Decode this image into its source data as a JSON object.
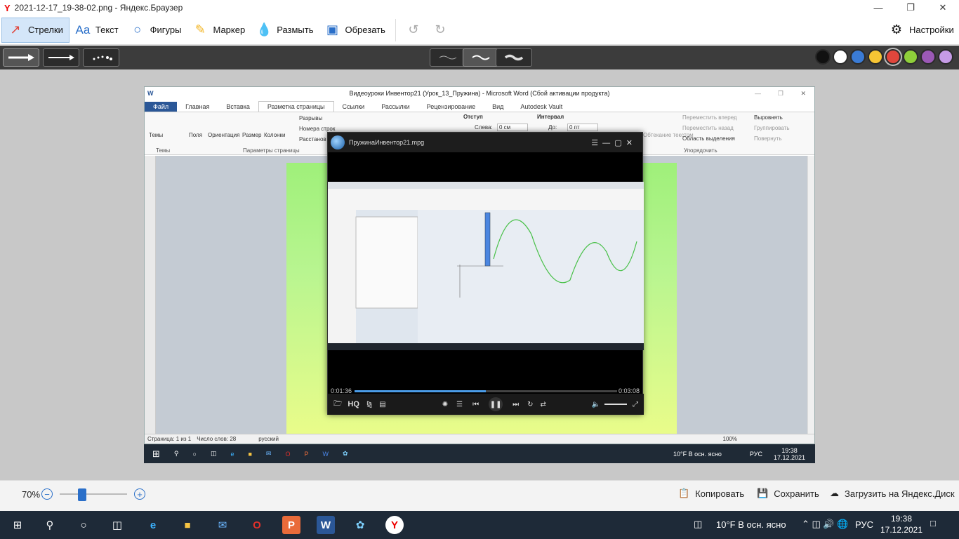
{
  "window": {
    "title": "2021-12-17_19-38-02.png - Яндекс.Браузер"
  },
  "toolbar": {
    "arrows": "Стрелки",
    "text": "Текст",
    "shapes": "Фигуры",
    "marker": "Маркер",
    "blur": "Размыть",
    "crop": "Обрезать",
    "settings": "Настройки"
  },
  "colors": [
    "#111111",
    "#ffffff",
    "#3a7bd5",
    "#f7c534",
    "#e0463c",
    "#8fcf3a",
    "#9b59b6",
    "#c59be6"
  ],
  "word": {
    "title": "Видеоуроки Инвентор21 (Урок_13_Пружина) - Microsoft Word (Сбой активации продукта)",
    "tabs": [
      "Файл",
      "Главная",
      "Вставка",
      "Разметка страницы",
      "Ссылки",
      "Рассылки",
      "Рецензирование",
      "Вид",
      "Autodesk Vault"
    ],
    "ribbon": {
      "themes": "Темы",
      "fields": "Поля",
      "orientation": "Ориентация",
      "size": "Размер",
      "columns": "Колонки",
      "breaks": "Разрывы",
      "line_numbers": "Номера строк",
      "hyphenation": "Расстанов",
      "indent": "Отступ",
      "left": "Слева:",
      "left_val": "0 см",
      "interval": "Интервал",
      "before": "До:",
      "before_val": "0 пт",
      "forward": "Переместить вперед",
      "backward": "Переместить назад",
      "selection": "Область выделения",
      "align": "Выровнять",
      "group": "Группировать",
      "rotate": "Повернуть",
      "wrap": "Обтекание текстом",
      "grp_themes": "Темы",
      "grp_page": "Параметры страницы",
      "grp_arrange": "Упорядочить"
    },
    "status": {
      "page": "Страница: 1 из 1",
      "words": "Число слов: 28",
      "lang": "русский",
      "zoom": "100%"
    },
    "taskbar": {
      "weather": "10°F  В осн. ясно",
      "lang": "РУС",
      "time": "19:38",
      "date": "17.12.2021"
    }
  },
  "player": {
    "title": "ПружинаИнвентор21.mpg",
    "elapsed": "0:01:36",
    "total": "0:03:08",
    "progress": 0.5,
    "hq": "HQ"
  },
  "bottom": {
    "zoom": "70%",
    "copy": "Копировать",
    "save": "Сохранить",
    "upload": "Загрузить на Яндекс.Диск"
  },
  "taskbar": {
    "weather": "10°F  В осн. ясно",
    "lang": "РУС",
    "time": "19:38",
    "date": "17.12.2021"
  }
}
